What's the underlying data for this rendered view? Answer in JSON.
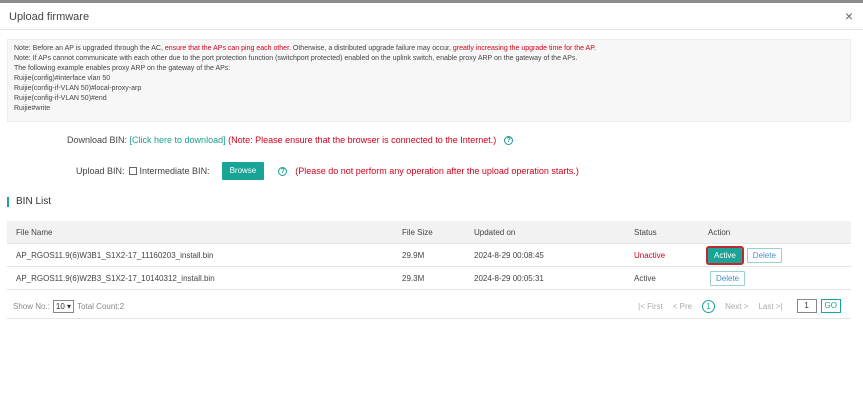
{
  "dialog": {
    "title": "Upload firmware",
    "close_label": "×"
  },
  "note": {
    "line1_a": "Note:  Before an AP is upgraded through the AC, ",
    "line1_red1": "ensure that the APs can ping each other",
    "line1_b": ". Otherwise, a distributed upgrade failure may occur, ",
    "line1_red2": "greatly increasing the upgrade time for the AP",
    "line1_c": ".",
    "line2": "Note: If APs cannot communicate with each other due to the port protection function (switchport protected) enabled on the uplink switch, enable proxy ARP on the gateway of the APs.",
    "line3": "The following example enables proxy ARP on the gateway of the APs:",
    "line4": "Ruijie(config)#interface vlan 50",
    "line5": "Ruijie(config-if-VLAN 50)#local-proxy-arp",
    "line6": "Ruijie(config-if-VLAN 50)#end",
    "line7": "Ruijie#write"
  },
  "download": {
    "label": "Download BIN: ",
    "link": "[Click here to download]",
    "warning": " (Note: Please ensure that the browser is connected to the Internet.)",
    "help_icon": "?"
  },
  "upload": {
    "label": "Upload BIN:",
    "checkbox_label": "Intermediate BIN:",
    "browse_label": "Browse",
    "help_icon": "?",
    "warning": "(Please do not perform any operation after the upload operation starts.)"
  },
  "bin_list": {
    "title": "BIN List",
    "columns": [
      "File Name",
      "File Size",
      "Updated on",
      "Status",
      "Action"
    ],
    "rows": [
      {
        "file": "AP_RGOS11.9(6)W3B1_S1X2-17_11160203_install.bin",
        "size": "29.9M",
        "updated": "2024-8-29 00:08:45",
        "status": "Unactive",
        "action1": "Active",
        "action2": "Delete"
      },
      {
        "file": "AP_RGOS11.9(6)W2B3_S1X2-17_10140312_install.bin",
        "size": "29.3M",
        "updated": "2024-8-29 00:05:31",
        "status": "Active",
        "action1": "Delete"
      }
    ]
  },
  "pager": {
    "show_label": "Show No.:",
    "page_size": "10",
    "total_label": "Total Count:2",
    "first": "First",
    "prev": "Pre",
    "current": "1",
    "next": "Next",
    "last": "Last",
    "page_input": "1",
    "go": "GO"
  },
  "colors": {
    "accent": "#1aa497",
    "warning": "#d0021b",
    "highlight_border": "#c0282d"
  }
}
